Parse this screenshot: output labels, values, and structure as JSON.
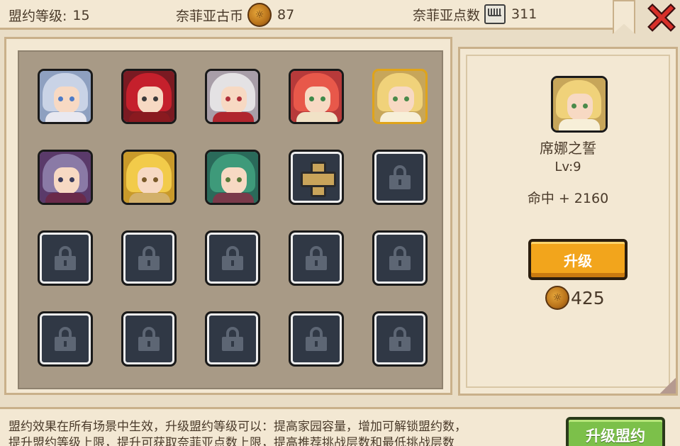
{
  "header": {
    "level_label": "盟约等级:",
    "level_value": "15",
    "coin_label": "奈菲亚古币",
    "coin_value": "87",
    "points_label": "奈菲亚点数",
    "points_value": "311"
  },
  "icons": {
    "coin": "coin-icon",
    "points": "chip-icon",
    "close": "close-icon",
    "lock": "lock-icon",
    "add": "plus-icon"
  },
  "grid": {
    "slots": [
      {
        "type": "hero",
        "hair": "#c9d3e6",
        "bg": "#8ea0c0",
        "eye": "#4e7bc7",
        "body": "#e8e8f0"
      },
      {
        "type": "hero",
        "hair": "#c5202c",
        "bg": "#7a1a22",
        "eye": "#3b3b3b",
        "body": "#8a1a20"
      },
      {
        "type": "hero",
        "hair": "#e4e2e4",
        "bg": "#a89ea8",
        "eye": "#b0303a",
        "body": "#b0262e"
      },
      {
        "type": "hero",
        "hair": "#e8584a",
        "bg": "#b73a3a",
        "eye": "#3e8a4a",
        "body": "#f1e2c6"
      },
      {
        "type": "hero",
        "hair": "#f0d27a",
        "bg": "#c7a65a",
        "eye": "#4a8a4a",
        "body": "#f7efd8",
        "selected": true
      },
      {
        "type": "hero",
        "hair": "#8a7aa6",
        "bg": "#5a3a6a",
        "eye": "#3a3a5a",
        "body": "#6a2a4a"
      },
      {
        "type": "hero",
        "hair": "#f2cb4a",
        "bg": "#c99a2a",
        "eye": "#7a5a2a",
        "body": "#d2b06a"
      },
      {
        "type": "hero",
        "hair": "#3e9a7a",
        "bg": "#2a6a5a",
        "eye": "#5a7a3a",
        "body": "#7a3a4a"
      },
      {
        "type": "add"
      },
      {
        "type": "locked"
      },
      {
        "type": "locked"
      },
      {
        "type": "locked"
      },
      {
        "type": "locked"
      },
      {
        "type": "locked"
      },
      {
        "type": "locked"
      },
      {
        "type": "locked"
      },
      {
        "type": "locked"
      },
      {
        "type": "locked"
      },
      {
        "type": "locked"
      },
      {
        "type": "locked"
      }
    ]
  },
  "detail": {
    "name": "席娜之誓",
    "level": "Lv:9",
    "stat": "命中 + 2160",
    "upgrade_label": "升级",
    "cost": "425"
  },
  "footer": {
    "line1": "盟约效果在所有场景中生效，升级盟约等级可以：提高家园容量，增加可解锁盟约数，",
    "line2": "提升盟约等级上限，提升可获取奈菲亚点数上限，提高推荐挑战层数和最低挑战层数",
    "button_label": "升级盟约"
  },
  "colors": {
    "accent_gold": "#f2a51c",
    "accent_green": "#7cc04a",
    "close_red": "#d8302a",
    "panel_bg": "#f3e8d3",
    "grid_bg": "#a89a86"
  }
}
